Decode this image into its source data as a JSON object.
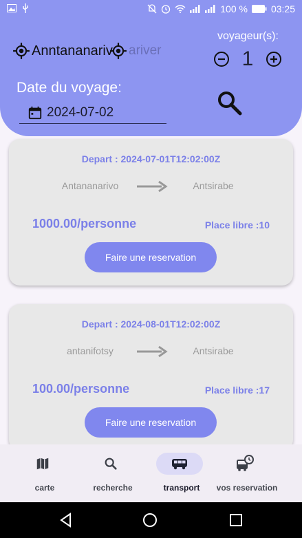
{
  "status_bar": {
    "battery": "100 %",
    "time": "03:25"
  },
  "search": {
    "departure": "Anntananariv",
    "arrival_placeholder": "ariver",
    "travellers_label": "voyageur(s):",
    "travellers_count": "1",
    "date_label": "Date du voyage:",
    "date_value": "2024-07-02"
  },
  "trips": [
    {
      "depart": "Depart : 2024-07-01T12:02:00Z",
      "from": "Antananarivo",
      "to": "Antsirabe",
      "price": "1000.00/personne",
      "places": "Place libre :10",
      "button": "Faire une reservation"
    },
    {
      "depart": "Depart : 2024-08-01T12:02:00Z",
      "from": "antanifotsy",
      "to": "Antsirabe",
      "price": "100.00/personne",
      "places": "Place libre :17",
      "button": "Faire une reservation"
    }
  ],
  "bottom_nav": [
    {
      "label": "carte",
      "icon": "map-icon",
      "active": false
    },
    {
      "label": "recherche",
      "icon": "search-icon",
      "active": false
    },
    {
      "label": "transport",
      "icon": "bus-icon",
      "active": true
    },
    {
      "label": "vos reservation",
      "icon": "bus-clock-icon",
      "active": false
    }
  ],
  "colors": {
    "header": "#8d95f1",
    "accent": "#7b80e8",
    "button": "#8087ee"
  }
}
